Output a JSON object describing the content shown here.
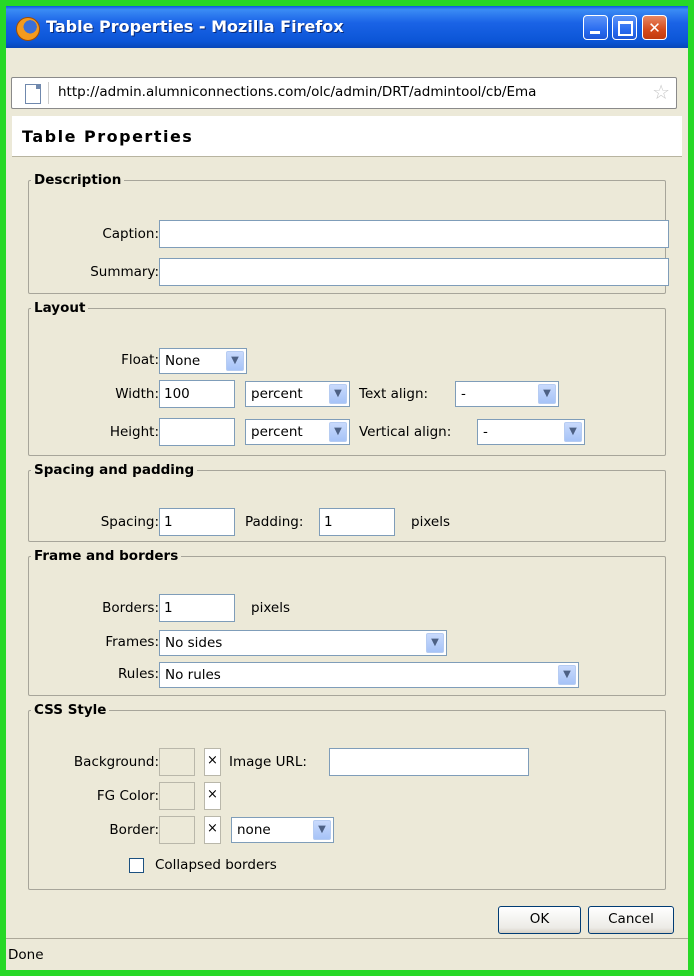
{
  "window": {
    "title": "Table Properties - Mozilla Firefox",
    "minimize_icon": "minimize-icon",
    "maximize_icon": "maximize-icon",
    "close_icon": "close-icon"
  },
  "urlbar": {
    "url": "http://admin.alumniconnections.com/olc/admin/DRT/admintool/cb/Ema"
  },
  "page": {
    "title": "Table Properties"
  },
  "description": {
    "legend": "Description",
    "caption_label": "Caption:",
    "caption_value": "",
    "summary_label": "Summary:",
    "summary_value": ""
  },
  "layout": {
    "legend": "Layout",
    "float_label": "Float:",
    "float_value": "None",
    "width_label": "Width:",
    "width_value": "100",
    "width_unit": "percent",
    "text_align_label": "Text align:",
    "text_align_value": "-",
    "height_label": "Height:",
    "height_value": "",
    "height_unit": "percent",
    "vertical_align_label": "Vertical align:",
    "vertical_align_value": "-"
  },
  "spacing": {
    "legend": "Spacing and padding",
    "spacing_label": "Spacing:",
    "spacing_value": "1",
    "padding_label": "Padding:",
    "padding_value": "1",
    "unit": "pixels"
  },
  "frame": {
    "legend": "Frame and borders",
    "borders_label": "Borders:",
    "borders_value": "1",
    "borders_unit": "pixels",
    "frames_label": "Frames:",
    "frames_value": "No sides",
    "rules_label": "Rules:",
    "rules_value": "No rules"
  },
  "css": {
    "legend": "CSS Style",
    "background_label": "Background:",
    "image_url_label": "Image URL:",
    "image_url_value": "",
    "fg_color_label": "FG Color:",
    "border_label": "Border:",
    "border_style_value": "none",
    "clear_symbol": "×",
    "collapsed_label": "Collapsed borders",
    "collapsed_checked": false
  },
  "buttons": {
    "ok": "OK",
    "cancel": "Cancel"
  },
  "status": {
    "text": "Done"
  }
}
